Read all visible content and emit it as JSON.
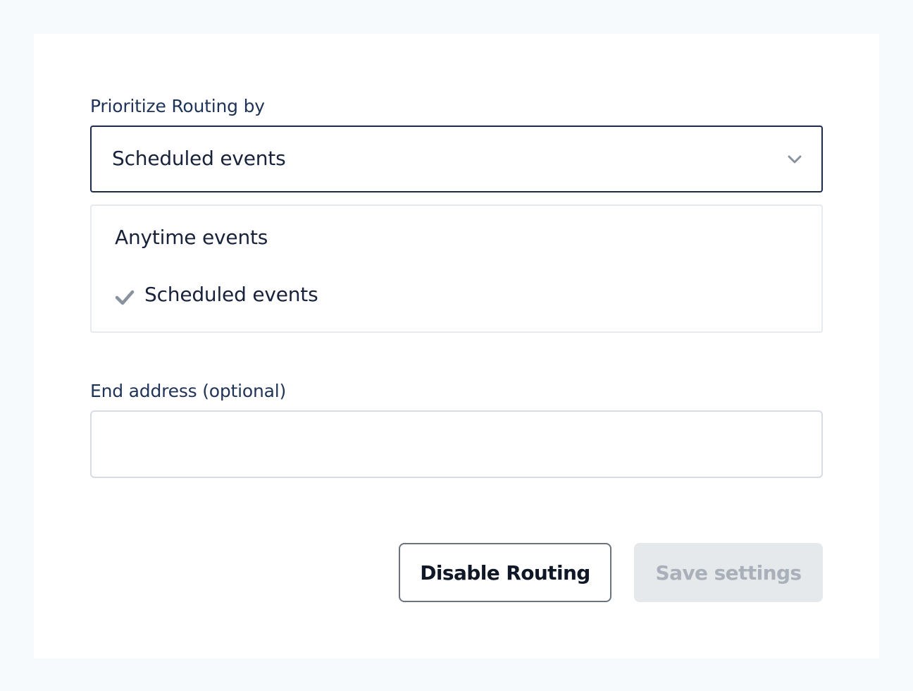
{
  "form": {
    "priority": {
      "label": "Prioritize Routing by",
      "selected_value": "Scheduled events",
      "options": [
        {
          "label": "Anytime events",
          "selected": false
        },
        {
          "label": "Scheduled events",
          "selected": true
        }
      ]
    },
    "end_address": {
      "label": "End address (optional)",
      "value": "",
      "placeholder": ""
    }
  },
  "actions": {
    "disable_label": "Disable Routing",
    "save_label": "Save settings",
    "save_disabled": true
  },
  "icons": {
    "select_chevron": "chevron-down-icon",
    "selected_check": "check-icon"
  },
  "colors": {
    "label_text": "#1f3358",
    "select_border": "#1c2b4a",
    "disabled_button_bg": "#e6e9ec",
    "disabled_button_text": "#a9b0ba",
    "icon_gray": "#8a929e"
  }
}
